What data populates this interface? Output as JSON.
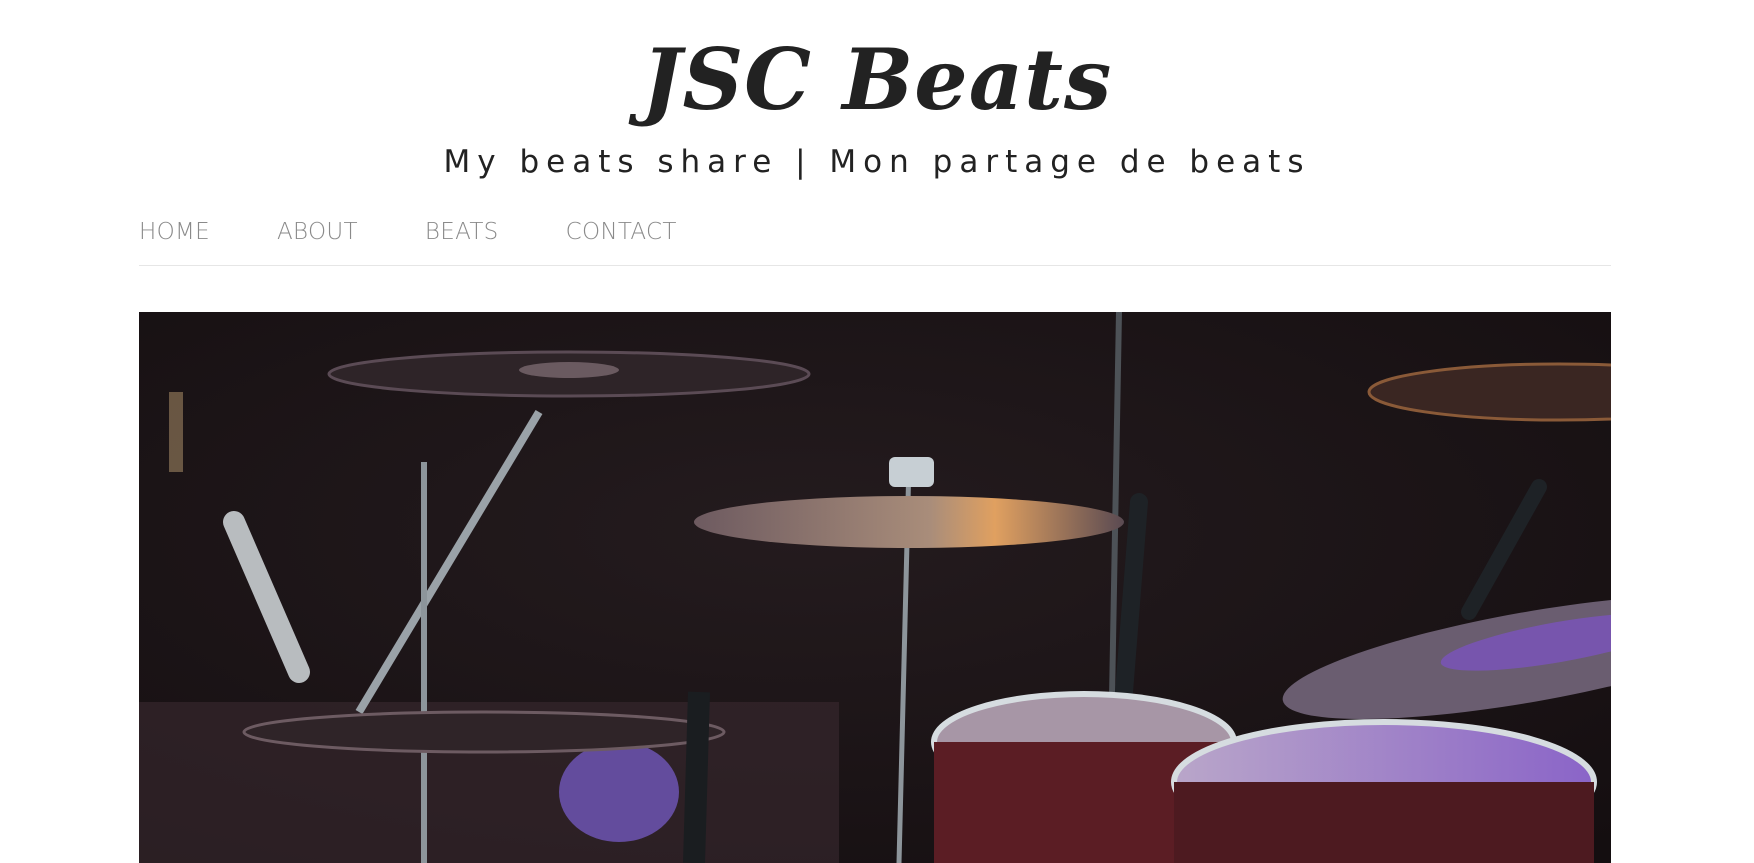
{
  "site": {
    "title": "JSC Beats",
    "tagline": "My beats share | Mon partage de beats"
  },
  "nav": {
    "items": [
      {
        "label": "HOME"
      },
      {
        "label": "ABOUT"
      },
      {
        "label": "BEATS"
      },
      {
        "label": "CONTACT"
      }
    ]
  },
  "colors": {
    "title": "#222222",
    "nav_text": "#8a8a8a",
    "divider": "#e6e6e6",
    "hero_bg": "#1b1416",
    "accent_purple": "#8e5bd6"
  },
  "hero": {
    "icon": "drum-kit-photo"
  }
}
